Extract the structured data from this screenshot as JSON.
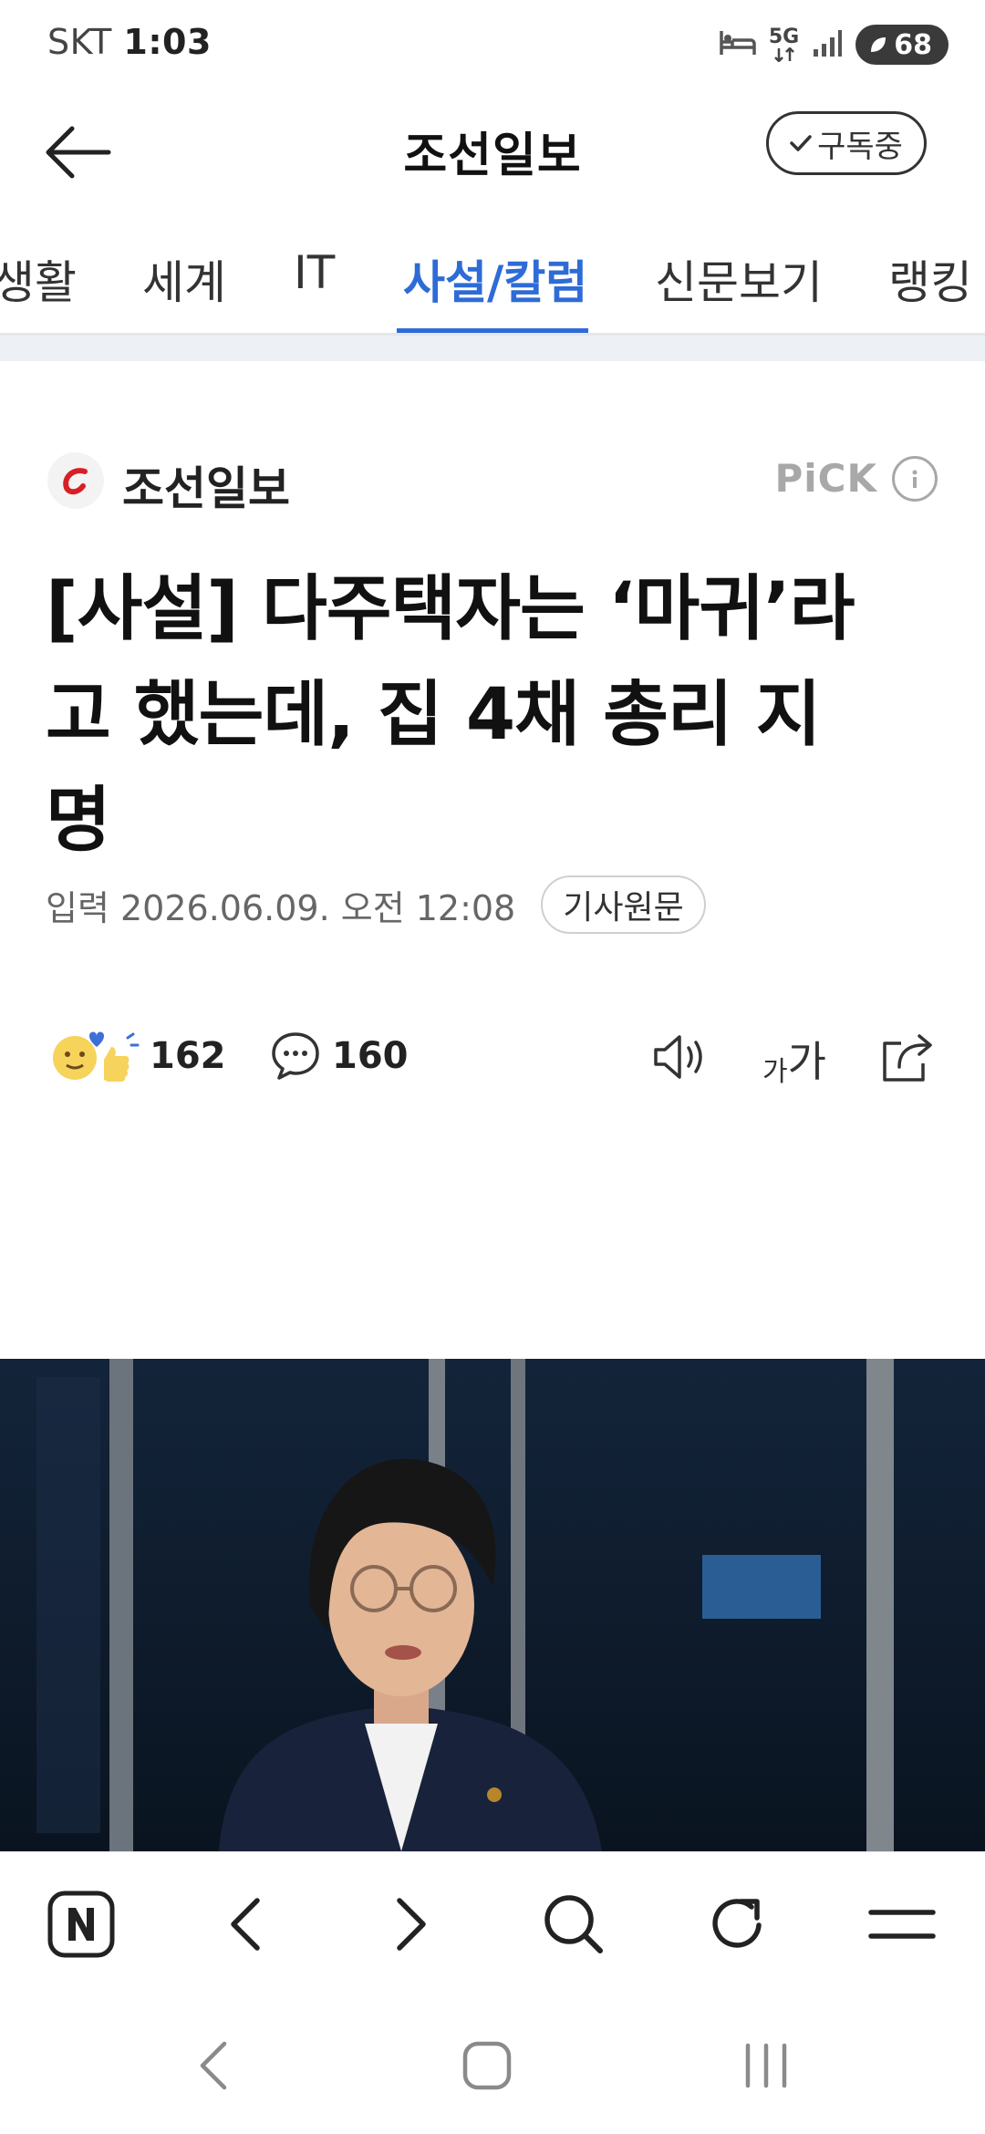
{
  "status_bar": {
    "carrier": "SKT",
    "time": "1:03",
    "network": "5G",
    "battery": "68",
    "icons": [
      "bed-icon",
      "5g-icon",
      "signal-icon",
      "battery-icon"
    ]
  },
  "header": {
    "title": "조선일보",
    "subscribe_label": "구독중",
    "icons": [
      "back-arrow-icon",
      "check-icon"
    ]
  },
  "tabs": [
    {
      "label": "생활"
    },
    {
      "label": "세계"
    },
    {
      "label": "IT"
    },
    {
      "label": "사설/칼럼",
      "active": true
    },
    {
      "label": "신문보기"
    },
    {
      "label": "랭킹"
    }
  ],
  "article": {
    "publisher": "조선일보",
    "pick_label": "PiCK",
    "headline_lines": [
      "[사설] 다주택자는 ‘마귀’라",
      "고 했는데, 집 4채 총리 지",
      "명"
    ],
    "date": "입력 2026.06.09. 오전 12:08",
    "original_label": "기사원문",
    "reactions_count": "162",
    "comments_count": "160",
    "font_small": "가",
    "font_big": "가",
    "action_icons": [
      "speaker-icon",
      "font-size-icon",
      "share-icon"
    ]
  },
  "browser_toolbar": {
    "icons": [
      "naver-home-icon",
      "back-icon",
      "forward-icon",
      "search-icon",
      "refresh-icon",
      "menu-icon"
    ]
  },
  "system_nav": {
    "icons": [
      "nav-back-icon",
      "nav-home-icon",
      "nav-recents-icon"
    ]
  },
  "colors": {
    "accent": "#2e6bd6",
    "logo_red": "#d81f26",
    "muted": "#a8a8a8"
  }
}
